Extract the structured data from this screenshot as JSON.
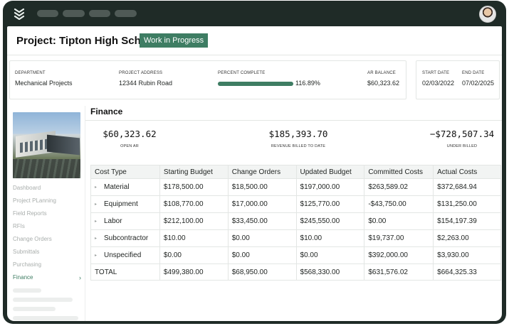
{
  "topbar": {
    "logo_icon": "stacked-chevrons-icon",
    "avatar_icon": "user-avatar"
  },
  "project": {
    "title": "Project: Tipton High School",
    "status": "Work in Progress"
  },
  "info": {
    "department_label": "DEPARTMENT",
    "department_value": "Mechanical Projects",
    "address_label": "PROJECT ADDRESS",
    "address_value": "12344 Rubin Road",
    "percent_label": "PERCENT COMPLETE",
    "percent_value": "116.89%",
    "progress_fraction": 1.0,
    "ar_label": "AR BALANCE",
    "ar_value": "$60,323.62",
    "start_label": "START DATE",
    "start_value": "02/03/2022",
    "end_label": "END DATE",
    "end_value": "07/02/2025"
  },
  "sidebar": {
    "items": [
      {
        "label": "Dashboard"
      },
      {
        "label": "Project PLanning"
      },
      {
        "label": "Field Reports"
      },
      {
        "label": "RFIs"
      },
      {
        "label": "Change Orders"
      },
      {
        "label": "Submittals"
      },
      {
        "label": "Purchasing"
      },
      {
        "label": "Finance",
        "chevron": "›"
      }
    ]
  },
  "finance": {
    "title": "Finance",
    "metrics": [
      {
        "value": "$60,323.62",
        "label": "OPEN AR"
      },
      {
        "value": "$185,393.70",
        "label": "REVENUE BILLED TO DATE"
      },
      {
        "value": "−$728,507.34",
        "label": "UNDER BILLED"
      }
    ],
    "table": {
      "headers": [
        "Cost Type",
        "Starting Budget",
        "Change Orders",
        "Updated Budget",
        "Committed Costs",
        "Actual Costs"
      ],
      "caret": "▸",
      "rows": [
        [
          "Material",
          "$178,500.00",
          "$18,500.00",
          "$197,000.00",
          "$263,589.02",
          "$372,684.94"
        ],
        [
          "Equipment",
          "$108,770.00",
          "$17,000.00",
          "$125,770.00",
          "-$43,750.00",
          "$131,250.00"
        ],
        [
          "Labor",
          "$212,100.00",
          "$33,450.00",
          "$245,550.00",
          "$0.00",
          "$154,197.39"
        ],
        [
          "Subcontractor",
          "$10.00",
          "$0.00",
          "$10.00",
          "$19,737.00",
          "$2,263.00"
        ],
        [
          "Unspecified",
          "$0.00",
          "$0.00",
          "$0.00",
          "$392,000.00",
          "$3,930.00"
        ]
      ],
      "total": [
        "TOTAL",
        "$499,380.00",
        "$68,950.00",
        "$568,330.00",
        "$631,576.02",
        "$664,325.33"
      ]
    }
  },
  "colors": {
    "accent": "#3e7d63",
    "frame": "#1f2b27"
  }
}
